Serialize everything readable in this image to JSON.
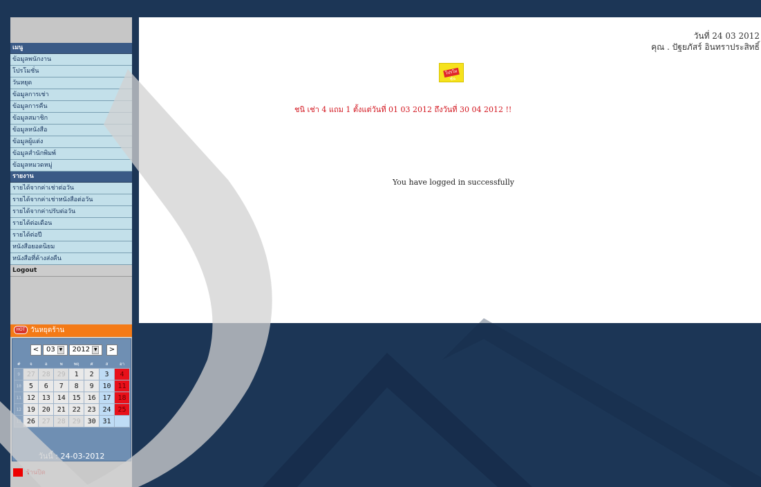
{
  "sidebar": {
    "menu_header": "เมนู",
    "menu_items": [
      "ข้อมูลพนักงาน",
      "โปรโมชั่น",
      "วันหยุด",
      "ข้อมูลการเช่า",
      "ข้อมูลการคืน",
      "ข้อมูลสมาชิก",
      "ข้อมูลหนังสือ",
      "ข้อมูลผู้แต่ง",
      "ข้อมูลสำนักพิมพ์",
      "ข้อมูลหมวดหมู่"
    ],
    "report_header": "รายงาน",
    "report_items": [
      "รายได้จากค่าเช่าต่อวัน",
      "รายได้จากค่าเช่าหนังสือต่อวัน",
      "รายได้จากค่าปรับต่อวัน",
      "รายได้ต่อเดือน",
      "รายได้ต่อปี",
      "หนังสือยอดนิยม",
      "หนังสือที่ค้างส่งคืน"
    ],
    "logout_label": "Logout"
  },
  "calendar": {
    "header_label": "วันหยุดร้าน",
    "hot_badge": "HOT",
    "prev_label": "<",
    "next_label": ">",
    "month_value": "03",
    "year_value": "2012",
    "day_headers": [
      "#",
      "จ",
      "อ",
      "พ",
      "พฤ",
      "ศ",
      "ส",
      "อา"
    ],
    "weeks": [
      {
        "wk": "9",
        "days": [
          "27",
          "28",
          "29",
          "1",
          "2",
          "3",
          "4"
        ]
      },
      {
        "wk": "10",
        "days": [
          "5",
          "6",
          "7",
          "8",
          "9",
          "10",
          "11"
        ]
      },
      {
        "wk": "11",
        "days": [
          "12",
          "13",
          "14",
          "15",
          "16",
          "17",
          "18"
        ]
      },
      {
        "wk": "12",
        "days": [
          "19",
          "20",
          "21",
          "22",
          "23",
          "24",
          "25"
        ]
      },
      {
        "wk": "13",
        "days": [
          "26",
          "27",
          "28",
          "29",
          "30",
          "31",
          ""
        ]
      }
    ],
    "today_label": "วันนี้ : 24-03-2012",
    "legend_label": "ร้านปิด",
    "colors": {
      "sunday_red": "#e8101a",
      "saturday_blue": "#bfdcf5",
      "header_orange": "#f47a16"
    }
  },
  "main": {
    "date_line": "วันที่  24 03 2012",
    "user_line": "คุณ . ปัฐยภัสร์ อินทราประสิทธิ์",
    "promo_badge": "โปรโมชั่น",
    "promo_text": "ชนิ เช่า 4 แถม 1 ตั้งแต่วันที่ 01 03 2012 ถึงวันที่ 30 04 2012 !!",
    "login_message": "You have logged in successfully"
  },
  "colors": {
    "background": "#1c3656",
    "menu_item": "#c3e0ea",
    "menu_header": "#3a5a86"
  }
}
